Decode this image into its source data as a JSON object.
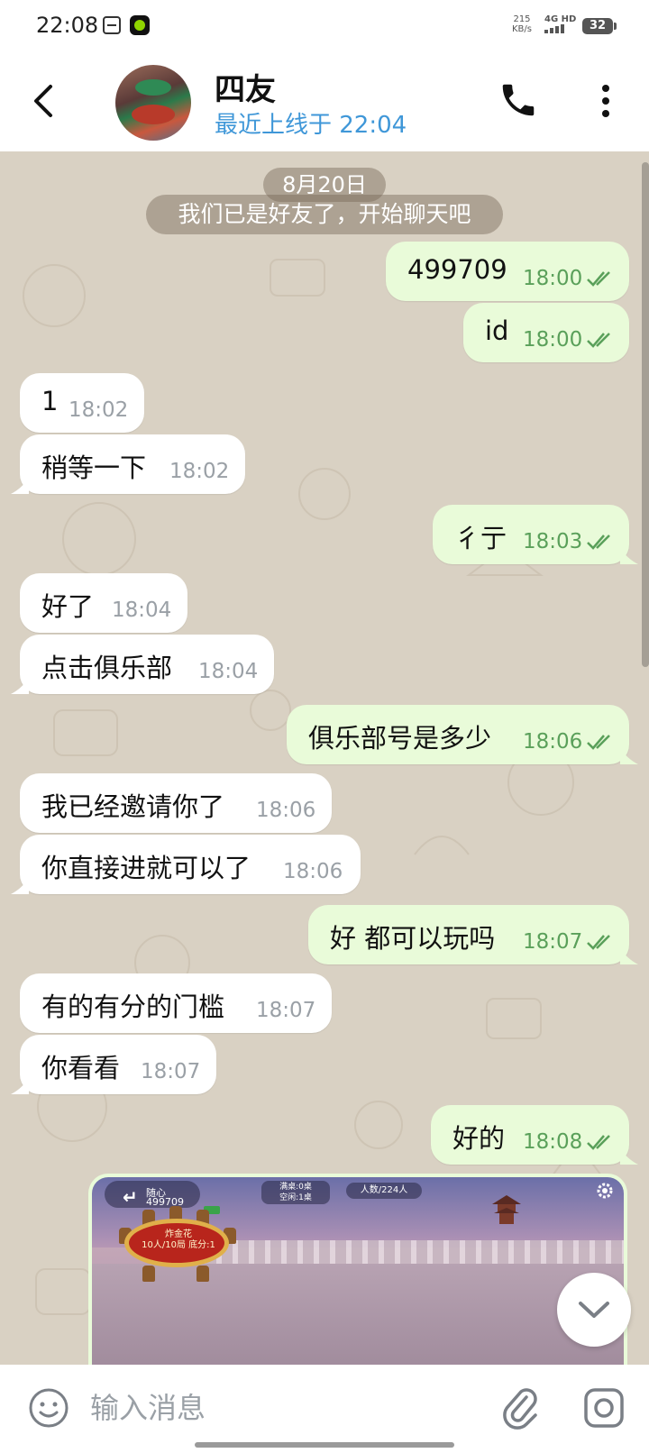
{
  "status_bar": {
    "time": "22:08",
    "net_speed_value": "215",
    "net_speed_unit": "KB/s",
    "net_type": "4G HD",
    "battery": "32"
  },
  "header": {
    "contact_name": "四友",
    "last_seen": "最近上线于 22:04"
  },
  "chat": {
    "date": "8月20日",
    "system_notice": "我们已是好友了，开始聊天吧",
    "messages": [
      {
        "dir": "out",
        "text": "499709",
        "time": "18:00"
      },
      {
        "dir": "out",
        "text": "id",
        "time": "18:00"
      },
      {
        "dir": "in",
        "text": "1",
        "time": "18:02"
      },
      {
        "dir": "in",
        "text": "稍等一下",
        "time": "18:02"
      },
      {
        "dir": "out",
        "text": "彳亍",
        "time": "18:03"
      },
      {
        "dir": "in",
        "text": "好了",
        "time": "18:04"
      },
      {
        "dir": "in",
        "text": "点击俱乐部",
        "time": "18:04"
      },
      {
        "dir": "out",
        "text": "俱乐部号是多少",
        "time": "18:06"
      },
      {
        "dir": "in",
        "text": "我已经邀请你了",
        "time": "18:06"
      },
      {
        "dir": "in",
        "text": "你直接进就可以了",
        "time": "18:06"
      },
      {
        "dir": "out",
        "text": "好 都可以玩吗",
        "time": "18:07"
      },
      {
        "dir": "in",
        "text": "有的有分的门槛",
        "time": "18:07"
      },
      {
        "dir": "in",
        "text": "你看看",
        "time": "18:07"
      },
      {
        "dir": "out",
        "text": "好的",
        "time": "18:08"
      }
    ],
    "shared_image": {
      "player_name": "随心",
      "player_id": "499709",
      "tables_line1": "满桌:0桌",
      "tables_line2": "空闲:1桌",
      "people_label": "人数",
      "people_total": "/224人",
      "table_name": "炸金花",
      "table_info": "10人/10局 底分:1"
    }
  },
  "input": {
    "placeholder": "输入消息"
  }
}
